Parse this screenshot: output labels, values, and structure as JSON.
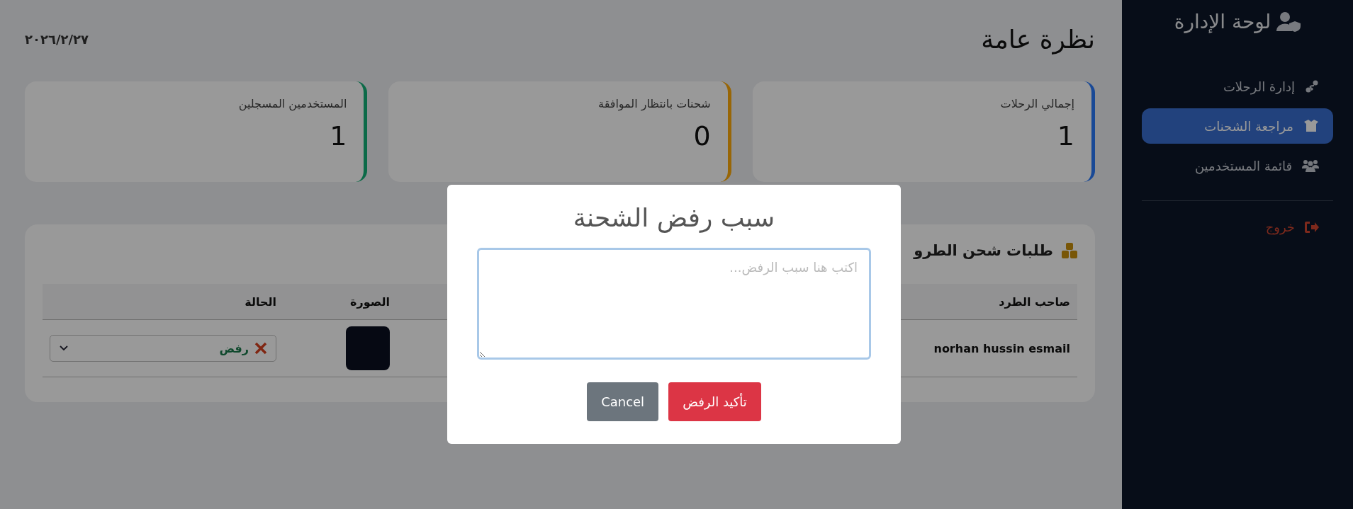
{
  "sidebar": {
    "title": "لوحة الإدارة",
    "items": [
      {
        "label": "إدارة الرحلات",
        "kind": "route",
        "selected": false
      },
      {
        "label": "مراجعة الشحنات",
        "kind": "box",
        "selected": true
      },
      {
        "label": "قائمة المستخدمين",
        "kind": "users",
        "selected": false
      }
    ],
    "logout": "خروج"
  },
  "header": {
    "title": "نظرة عامة",
    "date": "٢٠٢٦/٢/٢٧"
  },
  "cards": [
    {
      "label": "إجمالي الرحلات",
      "value": "1",
      "color": "#1a4a96"
    },
    {
      "label": "شحنات بانتظار الموافقة",
      "value": "0",
      "color": "#986606"
    },
    {
      "label": "المستخدمين المسجلين",
      "value": "1",
      "color": "#0c6a48"
    }
  ],
  "table": {
    "title": "طلبات شحن الطرو",
    "columns": [
      "صاحب الطرد",
      "الصورة",
      "الحالة"
    ],
    "rows": [
      {
        "owner": "norhan hussin esmail",
        "status": {
          "label": "رفض",
          "kind": "rejected"
        }
      }
    ]
  },
  "modal": {
    "title": "سبب رفض الشحنة",
    "placeholder": "اكتب هنا سبب الرفض...",
    "buttons": [
      {
        "label": "تأكيد الرفض",
        "kind": "danger"
      },
      {
        "label": "Cancel",
        "kind": "secondary"
      }
    ]
  }
}
